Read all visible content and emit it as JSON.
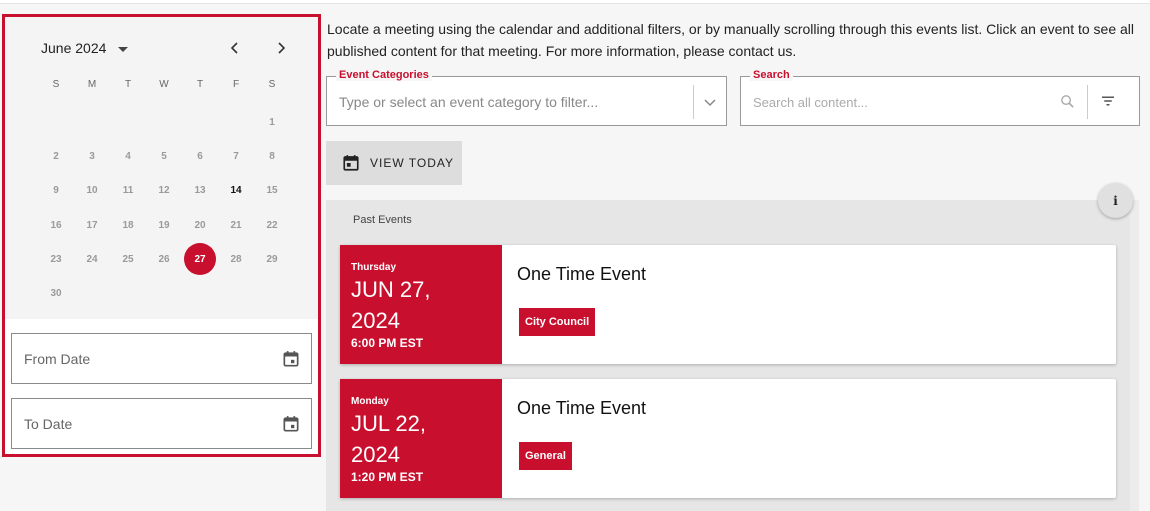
{
  "calendar": {
    "month_label": "June 2024",
    "weekdays": [
      "S",
      "M",
      "T",
      "W",
      "T",
      "F",
      "S"
    ],
    "days": [
      "",
      "",
      "",
      "",
      "",
      "",
      "1",
      "2",
      "3",
      "4",
      "5",
      "6",
      "7",
      "8",
      "9",
      "10",
      "11",
      "12",
      "13",
      "14",
      "15",
      "16",
      "17",
      "18",
      "19",
      "20",
      "21",
      "22",
      "23",
      "24",
      "25",
      "26",
      "27",
      "28",
      "29",
      "30"
    ],
    "today": "14",
    "selected": "27",
    "accent_color": "#c8102e"
  },
  "from_date": {
    "label": "From Date"
  },
  "to_date": {
    "label": "To Date"
  },
  "intro_text": "Locate a meeting using the calendar and additional filters, or by manually scrolling through this events list. Click an event to see all published content for that meeting. For more information, please contact us.",
  "category_filter": {
    "label": "Event Categories",
    "placeholder": "Type or select an event category to filter..."
  },
  "search": {
    "label": "Search",
    "placeholder": "Search all content..."
  },
  "view_today_label": "VIEW TODAY",
  "info_button_label": "i",
  "events_section": {
    "header": "Past Events",
    "events": [
      {
        "weekday": "Thursday",
        "month_day": "JUN 27,",
        "year": "2024",
        "time": "6:00 PM EST",
        "title": "One Time Event",
        "category": "City Council"
      },
      {
        "weekday": "Monday",
        "month_day": "JUL 22,",
        "year": "2024",
        "time": "1:20 PM EST",
        "title": "One Time Event",
        "category": "General"
      }
    ]
  }
}
